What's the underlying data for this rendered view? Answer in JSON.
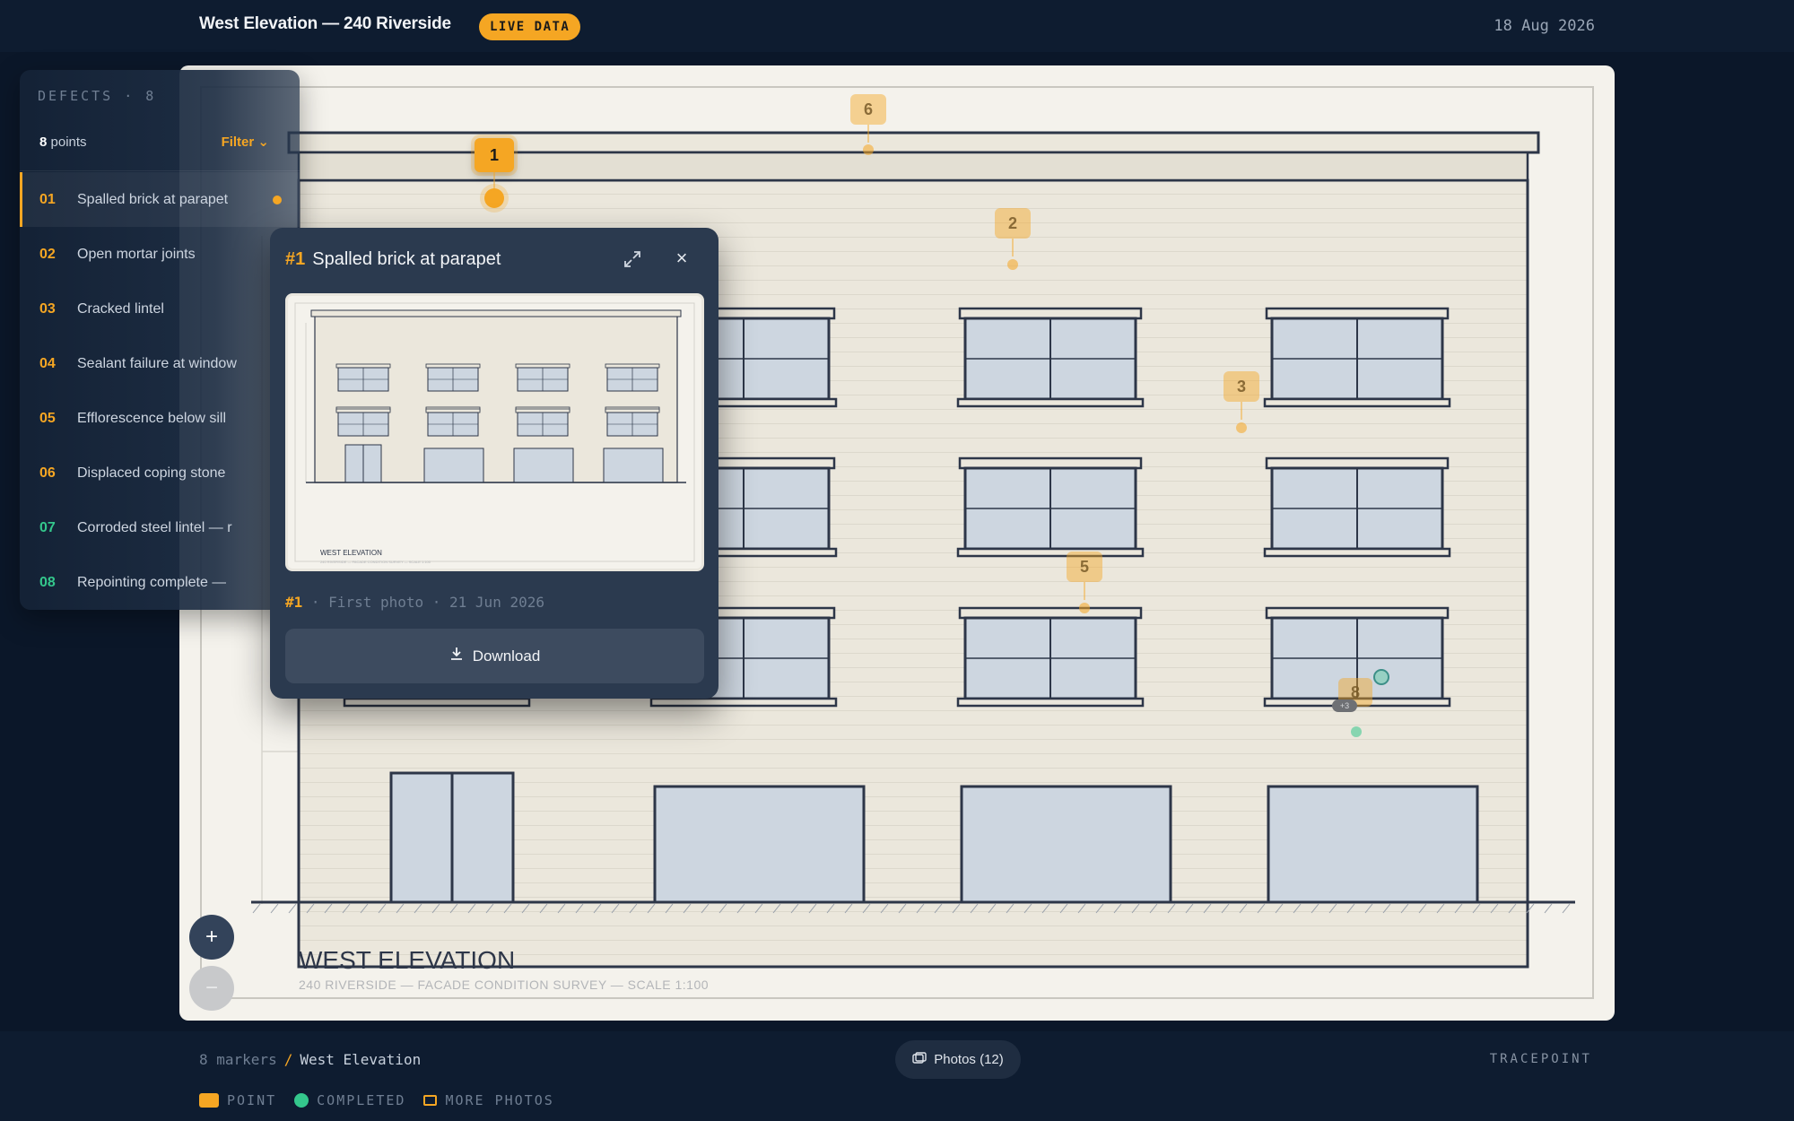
{
  "header": {
    "title": "West Elevation — 240 Riverside",
    "badge": "LIVE DATA",
    "date": "18 Aug 2026"
  },
  "drawing": {
    "title": "WEST ELEVATION",
    "subtitle": "240 RIVERSIDE — FACADE CONDITION SURVEY — SCALE 1:100"
  },
  "markers": [
    {
      "num": "1",
      "status": "point",
      "active": true
    },
    {
      "num": "2",
      "status": "point"
    },
    {
      "num": "3",
      "status": "point"
    },
    {
      "num": "5",
      "status": "point"
    },
    {
      "num": "6",
      "status": "point"
    },
    {
      "num": "8",
      "status": "completed",
      "more_photos": true,
      "photo_count": "+3"
    }
  ],
  "sidebar": {
    "heading": "DEFECTS · 8",
    "count_num": "8",
    "count_label": "points",
    "filter_label": "Filter",
    "items": [
      {
        "num": "01",
        "label": "Spalled brick at parapet",
        "status": "point"
      },
      {
        "num": "02",
        "label": "Open mortar joints",
        "status": "point"
      },
      {
        "num": "03",
        "label": "Cracked lintel",
        "status": "point"
      },
      {
        "num": "04",
        "label": "Sealant failure at window",
        "status": "point"
      },
      {
        "num": "05",
        "label": "Efflorescence below sill",
        "status": "point"
      },
      {
        "num": "06",
        "label": "Displaced coping stone",
        "status": "point"
      },
      {
        "num": "07",
        "label": "Corroded steel lintel — r",
        "status": "completed"
      },
      {
        "num": "08",
        "label": "Repointing complete — ",
        "status": "completed"
      }
    ]
  },
  "popup": {
    "hash": "#1",
    "title": "Spalled brick at parapet",
    "photo_caption": "WEST ELEVATION",
    "photo_subcaption": "240 RIVERSIDE — FACADE CONDITION SURVEY — SCALE 1:100",
    "meta_hash": "#1",
    "meta_text": " · First photo · 21 Jun 2026",
    "download_label": "Download"
  },
  "zoom": {
    "in": "+",
    "out": "−"
  },
  "footer": {
    "marker_count": "8 markers",
    "separator": "/",
    "current": "West Elevation",
    "photos_label": "Photos (12)",
    "brand": "TRACEPOINT",
    "legend": {
      "point": "POINT",
      "completed": "COMPLETED",
      "more_photos": "MORE PHOTOS"
    }
  },
  "colors": {
    "accent": "#f5a623",
    "completed": "#34c78c",
    "background": "#0b1729",
    "paper": "#f4f2ec"
  }
}
